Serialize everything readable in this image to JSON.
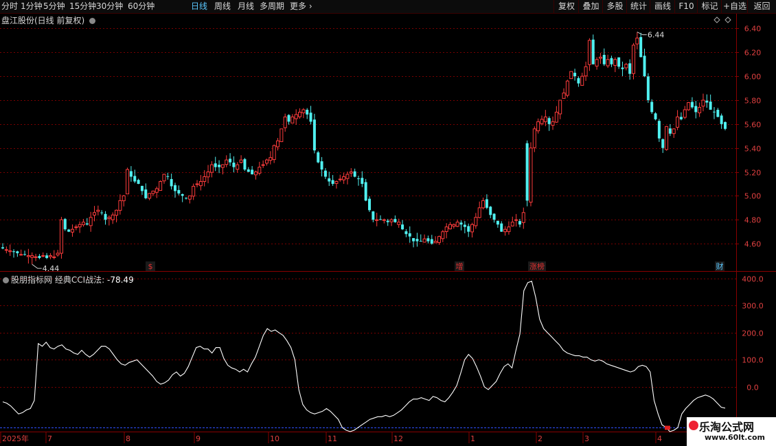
{
  "toolbar": {
    "periods": [
      "分时",
      "1分钟",
      "5分钟",
      "15分钟",
      "30分钟",
      "60分钟",
      "日线",
      "周线",
      "月线",
      "多周期",
      "更多"
    ],
    "active_period": "日线",
    "more_icon": "chevron-right-icon",
    "right_buttons": [
      "复权",
      "叠加",
      "多股",
      "统计",
      "画线",
      "F10",
      "标记",
      "+自选",
      "返回"
    ]
  },
  "main_chart": {
    "title": "盘江股份(日线 前复权)",
    "high_label": "6.44",
    "low_label": "4.44",
    "event_markers": [
      {
        "text": "$",
        "color": "#e03030"
      },
      {
        "text": "增",
        "color": "#e03030"
      },
      {
        "text": "涨榜",
        "color": "#e03030"
      },
      {
        "text": "财",
        "color": "#5ac8ff"
      }
    ]
  },
  "indicator": {
    "name": "股朋指标网",
    "formula": "经典CCI战法:",
    "value": "-78.49"
  },
  "x_axis": {
    "labels": [
      "2025年",
      "7",
      "8",
      "9",
      "10",
      "11",
      "12",
      "1",
      "2",
      "3",
      "4"
    ]
  },
  "watermark": {
    "text": "乐淘公式网",
    "url": "www.60lt.com"
  },
  "colors": {
    "up": "#ff3c3c",
    "down": "#50f0f0",
    "grid": "#7a0000",
    "cci": "#ffffff",
    "baseline": "#3050ff",
    "axis_text": "#e04040",
    "bg": "#000000"
  },
  "chart_data": [
    {
      "type": "candlestick",
      "title": "盘江股份(日线 前复权)",
      "y_ticks": [
        4.6,
        4.8,
        5.0,
        5.2,
        5.4,
        5.6,
        5.8,
        6.0,
        6.2,
        6.4
      ],
      "ylim": [
        4.44,
        6.5
      ],
      "grid": true,
      "x_months": [
        "7",
        "8",
        "9",
        "10",
        "11",
        "12",
        "1",
        "2",
        "3",
        "4"
      ],
      "annotations": [
        {
          "text": "6.44",
          "type": "max"
        },
        {
          "text": "4.44",
          "type": "min"
        }
      ],
      "close": [
        4.56,
        4.55,
        4.54,
        4.53,
        4.52,
        4.51,
        4.51,
        4.5,
        4.5,
        4.49,
        4.48,
        4.5,
        4.48,
        4.5,
        4.49,
        4.52,
        4.8,
        4.72,
        4.7,
        4.72,
        4.74,
        4.76,
        4.78,
        4.76,
        4.82,
        4.86,
        4.88,
        4.86,
        4.8,
        4.82,
        4.84,
        4.88,
        4.96,
        5.0,
        5.22,
        5.16,
        5.12,
        5.1,
        5.04,
        4.98,
        5.02,
        5.04,
        5.06,
        5.12,
        5.18,
        5.16,
        5.08,
        5.04,
        5.02,
        5.0,
        4.98,
        5.0,
        5.08,
        5.1,
        5.12,
        5.16,
        5.2,
        5.26,
        5.24,
        5.24,
        5.26,
        5.3,
        5.28,
        5.24,
        5.26,
        5.3,
        5.22,
        5.2,
        5.18,
        5.2,
        5.24,
        5.26,
        5.3,
        5.32,
        5.42,
        5.46,
        5.56,
        5.66,
        5.62,
        5.66,
        5.68,
        5.7,
        5.72,
        5.68,
        5.62,
        5.38,
        5.28,
        5.22,
        5.16,
        5.12,
        5.1,
        5.12,
        5.14,
        5.16,
        5.18,
        5.2,
        5.16,
        5.14,
        5.1,
        4.96,
        4.88,
        4.8,
        4.8,
        4.8,
        4.8,
        4.78,
        4.8,
        4.78,
        4.78,
        4.72,
        4.68,
        4.66,
        4.62,
        4.62,
        4.62,
        4.64,
        4.62,
        4.6,
        4.62,
        4.66,
        4.7,
        4.74,
        4.76,
        4.76,
        4.78,
        4.76,
        4.74,
        4.7,
        4.76,
        4.82,
        4.9,
        4.96,
        4.9,
        4.84,
        4.8,
        4.76,
        4.7,
        4.72,
        4.74,
        4.78,
        4.8,
        4.76,
        4.86,
        4.96,
        5.4,
        5.56,
        5.62,
        5.64,
        5.66,
        5.6,
        5.62,
        5.7,
        5.8,
        5.86,
        5.96,
        6.04,
        6.0,
        5.94,
        6.0,
        6.08,
        6.3,
        6.1,
        6.14,
        6.16,
        6.1,
        6.14,
        6.1,
        6.14,
        6.08,
        6.06,
        6.1,
        6.02,
        6.26,
        6.32,
        6.16,
        6.0,
        5.8,
        5.7,
        5.64,
        5.48,
        5.4,
        5.58,
        5.52,
        5.56,
        5.66,
        5.64,
        5.72,
        5.78,
        5.74,
        5.7,
        5.74,
        5.8,
        5.78,
        5.72,
        5.7,
        5.66,
        5.6,
        5.56
      ]
    },
    {
      "type": "line",
      "title": "经典CCI战法",
      "series": [
        {
          "name": "经典CCI战法",
          "values": [
            -55,
            -60,
            -70,
            -85,
            -100,
            -95,
            -85,
            -80,
            -50,
            160,
            150,
            165,
            145,
            140,
            150,
            155,
            140,
            135,
            125,
            120,
            135,
            120,
            110,
            120,
            135,
            150,
            150,
            140,
            120,
            100,
            85,
            80,
            90,
            95,
            100,
            85,
            70,
            55,
            40,
            20,
            10,
            15,
            25,
            45,
            55,
            40,
            50,
            75,
            110,
            145,
            150,
            140,
            140,
            125,
            145,
            145,
            105,
            80,
            70,
            65,
            55,
            65,
            55,
            85,
            110,
            150,
            190,
            215,
            205,
            210,
            200,
            190,
            170,
            145,
            100,
            -10,
            -65,
            -85,
            -95,
            -100,
            -95,
            -90,
            -80,
            -90,
            -105,
            -120,
            -150,
            -160,
            -165,
            -160,
            -150,
            -140,
            -130,
            -120,
            -115,
            -110,
            -110,
            -105,
            -110,
            -105,
            -95,
            -85,
            -70,
            -55,
            -45,
            -45,
            -40,
            -45,
            -50,
            -35,
            -40,
            -50,
            -55,
            -40,
            -20,
            5,
            50,
            100,
            120,
            105,
            75,
            40,
            0,
            -10,
            5,
            20,
            50,
            75,
            85,
            70,
            135,
            195,
            355,
            385,
            390,
            330,
            250,
            215,
            200,
            185,
            170,
            155,
            135,
            125,
            120,
            115,
            115,
            110,
            110,
            100,
            95,
            100,
            95,
            85,
            80,
            75,
            70,
            65,
            60,
            55,
            60,
            75,
            80,
            75,
            55,
            -50,
            -100,
            -140,
            -150,
            -165,
            -160,
            -150,
            -100,
            -80,
            -65,
            -50,
            -40,
            -35,
            -30,
            -35,
            -45,
            -60,
            -75,
            -78.49
          ]
        }
      ],
      "y_ticks": [
        0,
        100,
        200,
        300,
        400
      ],
      "ylim": [
        -165,
        420
      ],
      "baseline": -150
    }
  ]
}
